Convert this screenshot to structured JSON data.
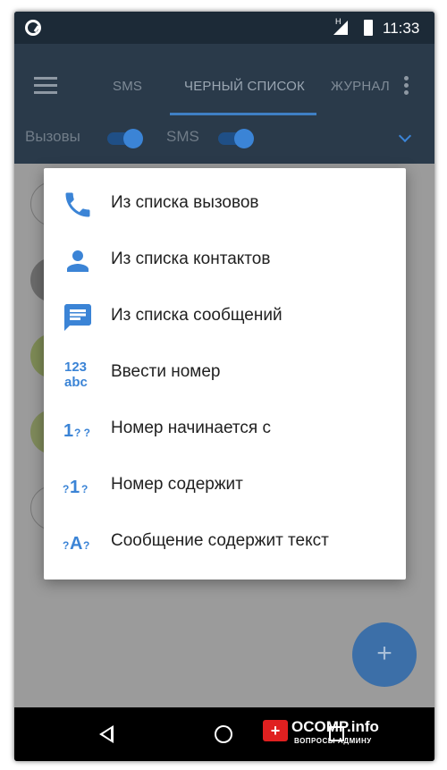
{
  "status_bar": {
    "time": "11:33",
    "network_label": "H",
    "icons": [
      "shield-icon",
      "signal-icon",
      "battery-icon"
    ]
  },
  "toolbar": {
    "tabs": [
      {
        "label": "SMS"
      },
      {
        "label": "ЧЕРНЫЙ СПИСОК",
        "active": true
      },
      {
        "label": "ЖУРНАЛ"
      }
    ]
  },
  "filters": {
    "calls_label": "Вызовы",
    "calls_enabled": true,
    "sms_label": "SMS",
    "sms_enabled": true
  },
  "dialog": {
    "items": [
      {
        "label": "Из списка вызовов",
        "icon": "phone-icon"
      },
      {
        "label": "Из списка контактов",
        "icon": "person-icon"
      },
      {
        "label": "Из списка сообщений",
        "icon": "message-icon"
      },
      {
        "label": "Ввести номер",
        "icon": "keypad-icon",
        "icon_text": [
          "123",
          "abc"
        ]
      },
      {
        "label": "Номер начинается с",
        "icon": "starts-with-icon",
        "icon_text": [
          "1",
          "? ?"
        ]
      },
      {
        "label": "Номер содержит",
        "icon": "contains-icon",
        "icon_text": [
          "?",
          "1",
          "?"
        ]
      },
      {
        "label": "Сообщение содержит текст",
        "icon": "message-contains-icon",
        "icon_text": [
          "?",
          "A",
          "?"
        ]
      }
    ]
  },
  "fab": {
    "label": "+"
  },
  "watermark": {
    "title": "OCOMP.info",
    "subtitle": "ВОПРОСЫ АДМИНУ",
    "badge": "+"
  },
  "colors": {
    "accent": "#3b84d6",
    "toolbar": "#2a3a4a",
    "scrim": "#9b9b9b",
    "dialog": "#ffffff"
  }
}
